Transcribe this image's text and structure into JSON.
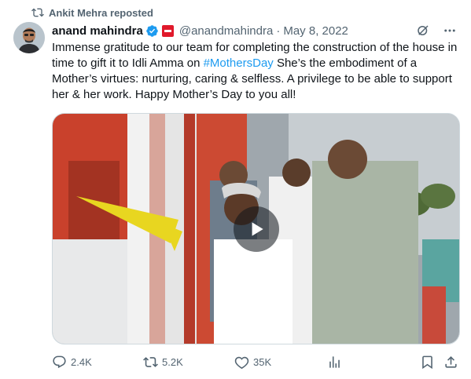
{
  "repost": {
    "label": "Ankit Mehra reposted",
    "icon": "repost-icon"
  },
  "author": {
    "name": "anand mahindra",
    "handle": "@anandmahindra",
    "date": "May 8, 2022",
    "verified_icon": "verified-badge-icon",
    "affiliate_icon": "affiliate-badge-icon"
  },
  "tweet": {
    "text_before": "Immense gratitude to our team for completing the construction of the house in time to gift it to Idli Amma on ",
    "hashtag": "#MothersDay",
    "text_after": " She’s the embodiment of a Mother’s virtues: nurturing, caring & selfless. A privilege to be able to support her & her work. Happy Mother’s Day to you all!"
  },
  "media": {
    "type": "video",
    "play_icon": "play-icon"
  },
  "actions": {
    "replies": "2.4K",
    "reposts": "5.2K",
    "likes": "35K"
  },
  "colors": {
    "accent": "#1d9bf0",
    "secondary_text": "#536471",
    "primary_text": "#0f1419"
  }
}
